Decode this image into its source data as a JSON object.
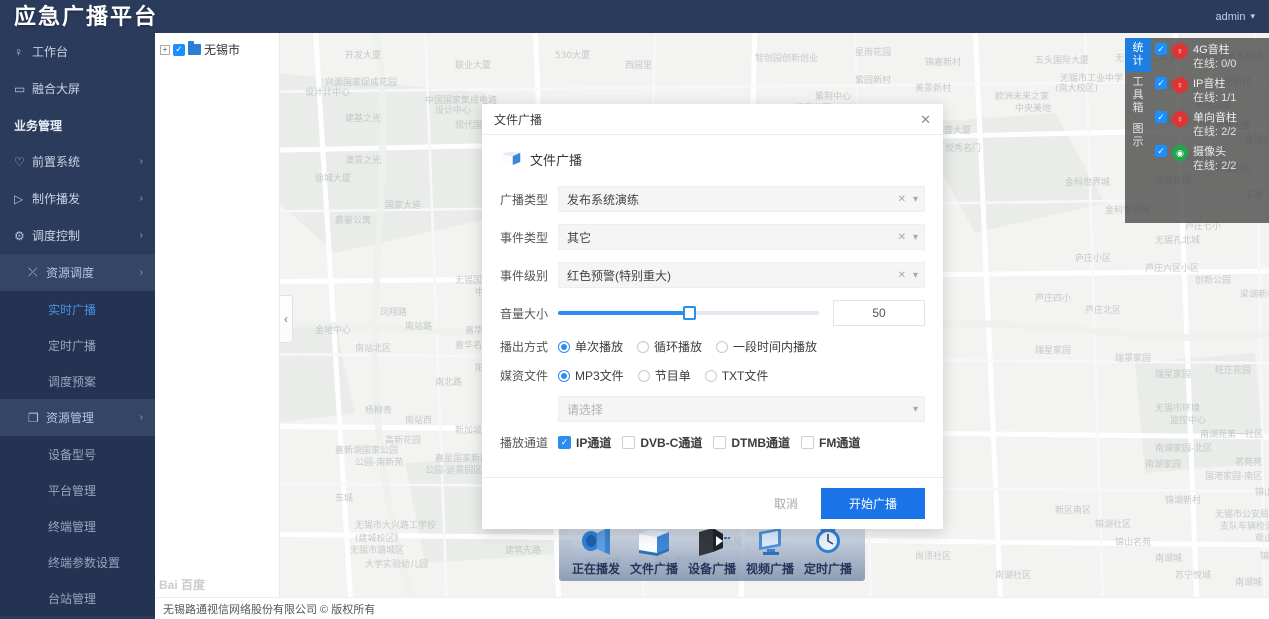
{
  "topbar": {
    "brand": "应急广播平台",
    "user": "admin",
    "caret": "▾"
  },
  "sidebar": {
    "items": [
      {
        "label": "工作台",
        "icon": "lightbulb-icon",
        "glyph": "♀",
        "type": "item"
      },
      {
        "label": "融合大屏",
        "icon": "monitor-icon",
        "glyph": "▭",
        "type": "item"
      },
      {
        "label": "业务管理",
        "icon": "",
        "glyph": "",
        "type": "group"
      },
      {
        "label": "前置系统",
        "icon": "heart-icon",
        "glyph": "♡",
        "type": "item",
        "arrow": "›"
      },
      {
        "label": "制作播发",
        "icon": "play-icon",
        "glyph": "▷",
        "type": "item",
        "arrow": "›"
      },
      {
        "label": "调度控制",
        "icon": "gear-icon",
        "glyph": "⚙",
        "type": "item",
        "arrow": "›"
      }
    ],
    "sub1_resource_dispatch": {
      "label": "资源调度",
      "glyph": "⤫",
      "arrow": "›"
    },
    "dispatch_children": [
      {
        "label": "实时广播",
        "active": true
      },
      {
        "label": "定时广播",
        "active": false
      },
      {
        "label": "调度预案",
        "active": false
      }
    ],
    "sub1_resource_mgmt": {
      "label": "资源管理",
      "glyph": "❐",
      "arrow": "›"
    },
    "resource_children": [
      {
        "label": "设备型号"
      },
      {
        "label": "平台管理"
      },
      {
        "label": "终端管理"
      },
      {
        "label": "终端参数设置"
      },
      {
        "label": "台站管理"
      }
    ]
  },
  "tree": {
    "expander": "+",
    "checked": "✓",
    "node_label": "无锡市"
  },
  "map": {
    "collapse_glyph": "‹",
    "watermark": "Bai 百度"
  },
  "stats_panel": {
    "tabs": [
      {
        "label": "统计",
        "active": true
      },
      {
        "label": "工具箱",
        "active": false
      },
      {
        "label": "图示",
        "active": false
      }
    ],
    "rows": [
      {
        "checked": true,
        "name": "4G音柱",
        "online_label": "在线:",
        "online_value": "0/0",
        "color": "#e03434",
        "pin_glyph": "♀"
      },
      {
        "checked": true,
        "name": "IP音柱",
        "online_label": "在线:",
        "online_value": "1/1",
        "color": "#e03434",
        "pin_glyph": "♀"
      },
      {
        "checked": true,
        "name": "单向音柱",
        "online_label": "在线:",
        "online_value": "2/2",
        "color": "#e03434",
        "pin_glyph": "♀"
      },
      {
        "checked": true,
        "name": "摄像头",
        "online_label": "在线:",
        "online_value": "2/2",
        "color": "#1fa84a",
        "pin_glyph": "◉"
      }
    ]
  },
  "dock": {
    "items": [
      {
        "label": "正在播发",
        "icon": "speaker-icon"
      },
      {
        "label": "文件广播",
        "icon": "folder-icon"
      },
      {
        "label": "设备广播",
        "icon": "device-play-icon"
      },
      {
        "label": "视频广播",
        "icon": "video-screen-icon"
      },
      {
        "label": "定时广播",
        "icon": "clock-icon"
      }
    ]
  },
  "footer": {
    "copyright": "无锡路通视信网络股份有限公司 © 版权所有"
  },
  "modal": {
    "title": "文件广播",
    "close_glyph": "✕",
    "heading": "文件广播",
    "heading_icon": "folder-icon",
    "fields": {
      "broadcast_type": {
        "label": "广播类型",
        "value": "发布系统演练",
        "clear_glyph": "✕",
        "caret_glyph": "▾"
      },
      "event_type": {
        "label": "事件类型",
        "value": "其它",
        "clear_glyph": "✕",
        "caret_glyph": "▾"
      },
      "event_level": {
        "label": "事件级别",
        "value": "红色预警(特别重大)",
        "clear_glyph": "✕",
        "caret_glyph": "▾"
      },
      "volume": {
        "label": "音量大小",
        "value": "50",
        "percent": 50
      },
      "play_mode": {
        "label": "播出方式",
        "options": [
          {
            "label": "单次播放",
            "selected": true
          },
          {
            "label": "循环播放",
            "selected": false
          },
          {
            "label": "一段时间内播放",
            "selected": false
          }
        ]
      },
      "media_file": {
        "label": "媒资文件",
        "options": [
          {
            "label": "MP3文件",
            "selected": true
          },
          {
            "label": "节目单",
            "selected": false
          },
          {
            "label": "TXT文件",
            "selected": false
          }
        ]
      },
      "media_select": {
        "placeholder": "请选择",
        "caret_glyph": "▾"
      },
      "channels": {
        "label": "播放通道",
        "options": [
          {
            "label": "IP通道",
            "checked": true
          },
          {
            "label": "DVB-C通道",
            "checked": false
          },
          {
            "label": "DTMB通道",
            "checked": false
          },
          {
            "label": "FM通道",
            "checked": false
          }
        ]
      }
    },
    "cancel_label": "取消",
    "submit_label": "开始广播"
  },
  "colors": {
    "navy": "#2b3b5c",
    "primary": "#1b73e8",
    "slider": "#2d8cf0",
    "tab_active": "#1e7fe0"
  }
}
